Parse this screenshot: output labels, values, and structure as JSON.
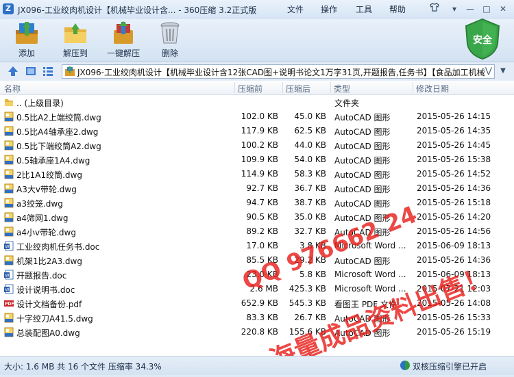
{
  "window": {
    "title": "JX096-工业绞肉机设计【机械毕业设计含... - 360压缩 3.2正式版",
    "menus": [
      "文件",
      "操作",
      "工具",
      "帮助"
    ]
  },
  "toolbar": {
    "buttons": [
      {
        "label": "添加",
        "icon": "add-books-icon"
      },
      {
        "label": "解压到",
        "icon": "extract-folder-icon"
      },
      {
        "label": "一键解压",
        "icon": "one-click-extract-icon"
      },
      {
        "label": "删除",
        "icon": "trash-icon"
      }
    ],
    "security_label": "安全"
  },
  "address": {
    "path": "JX096-工业绞肉机设计【机械毕业设计含12张CAD图+说明书论文1万字31页,开题报告,任务书】【食品加工机械"
  },
  "columns": {
    "name": "名称",
    "before": "压缩前",
    "after": "压缩后",
    "type": "类型",
    "modified": "修改日期"
  },
  "files": [
    {
      "name": ".. (上级目录)",
      "before": "",
      "after": "",
      "type": "文件夹",
      "date": "",
      "icon": "folder-icon"
    },
    {
      "name": "0.5比A2上端绞筒.dwg",
      "before": "102.0 KB",
      "after": "45.0 KB",
      "type": "AutoCAD 图形",
      "date": "2015-05-26 14:15",
      "icon": "dwg-icon"
    },
    {
      "name": "0.5比A4轴承座2.dwg",
      "before": "117.9 KB",
      "after": "62.5 KB",
      "type": "AutoCAD 图形",
      "date": "2015-05-26 14:35",
      "icon": "dwg-icon"
    },
    {
      "name": "0.5比下端绞筒A2.dwg",
      "before": "100.2 KB",
      "after": "44.0 KB",
      "type": "AutoCAD 图形",
      "date": "2015-05-26 14:45",
      "icon": "dwg-icon"
    },
    {
      "name": "0.5轴承座1A4.dwg",
      "before": "109.9 KB",
      "after": "54.0 KB",
      "type": "AutoCAD 图形",
      "date": "2015-05-26 15:38",
      "icon": "dwg-icon"
    },
    {
      "name": "2比1A1绞筒.dwg",
      "before": "114.9 KB",
      "after": "58.3 KB",
      "type": "AutoCAD 图形",
      "date": "2015-05-26 14:52",
      "icon": "dwg-icon"
    },
    {
      "name": "A3大v带轮.dwg",
      "before": "92.7 KB",
      "after": "36.7 KB",
      "type": "AutoCAD 图形",
      "date": "2015-05-26 14:36",
      "icon": "dwg-icon"
    },
    {
      "name": "a3绞笼.dwg",
      "before": "94.7 KB",
      "after": "38.7 KB",
      "type": "AutoCAD 图形",
      "date": "2015-05-26 15:18",
      "icon": "dwg-icon"
    },
    {
      "name": "a4筛网1.dwg",
      "before": "90.5 KB",
      "after": "35.0 KB",
      "type": "AutoCAD 图形",
      "date": "2015-05-26 14:20",
      "icon": "dwg-icon"
    },
    {
      "name": "a4小v带轮.dwg",
      "before": "89.2 KB",
      "after": "32.7 KB",
      "type": "AutoCAD 图形",
      "date": "2015-05-26 14:56",
      "icon": "dwg-icon"
    },
    {
      "name": "工业绞肉机任务书.doc",
      "before": "17.0 KB",
      "after": "3.8 KB",
      "type": "Microsoft Word ...",
      "date": "2015-06-09 18:13",
      "icon": "doc-icon"
    },
    {
      "name": "机架1比2A3.dwg",
      "before": "85.5 KB",
      "after": "29.2 KB",
      "type": "AutoCAD 图形",
      "date": "2015-05-26 14:36",
      "icon": "dwg-icon"
    },
    {
      "name": "开题报告.doc",
      "before": "23.0 KB",
      "after": "5.8 KB",
      "type": "Microsoft Word ...",
      "date": "2015-06-09 18:13",
      "icon": "doc-icon"
    },
    {
      "name": "设计说明书.doc",
      "before": "2.6 MB",
      "after": "425.3 KB",
      "type": "Microsoft Word ...",
      "date": "2015-07-21 12:03",
      "icon": "doc-icon"
    },
    {
      "name": "设计文档备份.pdf",
      "before": "652.9 KB",
      "after": "545.3 KB",
      "type": "看图王 PDF 文件",
      "date": "2015-05-26 14:08",
      "icon": "pdf-icon"
    },
    {
      "name": "十字绞刀A41.5.dwg",
      "before": "83.3 KB",
      "after": "26.7 KB",
      "type": "AutoCAD 图形",
      "date": "2015-05-26 15:33",
      "icon": "dwg-icon"
    },
    {
      "name": "总装配图A0.dwg",
      "before": "220.8 KB",
      "after": "155.6 KB",
      "type": "AutoCAD 图形",
      "date": "2015-05-26 15:19",
      "icon": "dwg-icon"
    }
  ],
  "status": {
    "summary": "大小: 1.6 MB 共 16 个文件 压缩率 34.3%",
    "engine": "双核压缩引擎已开启"
  },
  "watermark": {
    "line1": "QQ 976662 24",
    "line2": "海量成品资料出售！"
  },
  "colors": {
    "watermark": "#e8211d",
    "accent": "#2e6fc8",
    "security": "#3aa64a"
  }
}
